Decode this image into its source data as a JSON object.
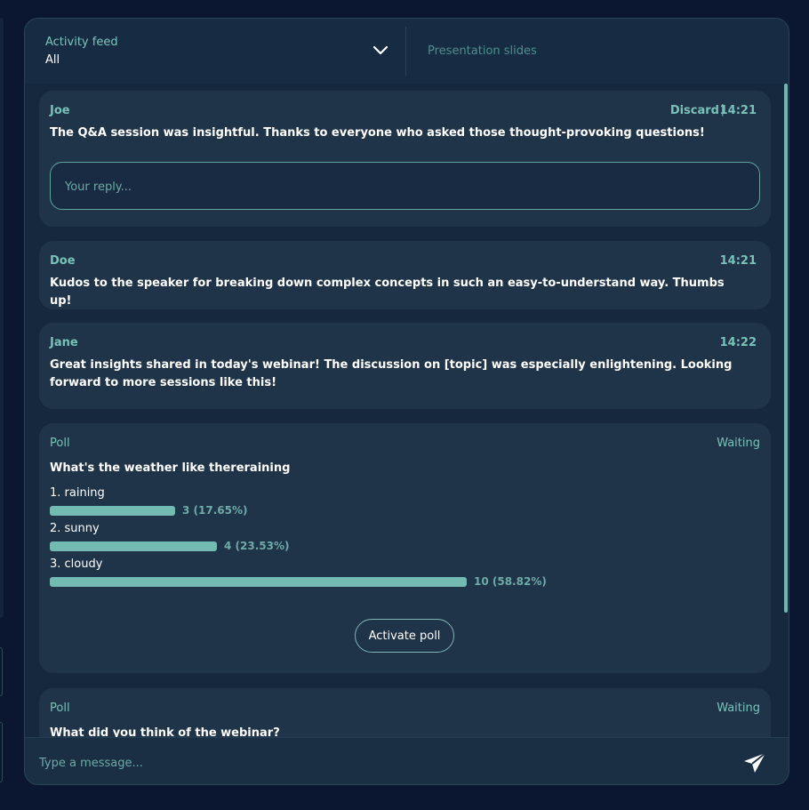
{
  "header": {
    "feed_label": "Activity feed",
    "feed_value": "All",
    "slides_tab": "Presentation slides"
  },
  "messages": [
    {
      "name": "Joe",
      "discard": "Discard",
      "separator": "|",
      "time": "14:21",
      "text": "The Q&A session was insightful. Thanks to everyone who asked those thought-provoking questions!",
      "reply_placeholder": "Your reply..."
    },
    {
      "name": "Doe",
      "time": "14:21",
      "text": "Kudos to the speaker for breaking down complex concepts in such an easy-to-understand way. Thumbs up!"
    },
    {
      "name": "Jane",
      "time": "14:22",
      "text": "Great insights shared in today's webinar! The discussion on [topic] was especially enlightening. Looking forward to more sessions like this!"
    }
  ],
  "polls": [
    {
      "tag": "Poll",
      "status": "Waiting",
      "question": "What's the weather like thereraining",
      "options": [
        {
          "label": "1. raining",
          "value": "3 (17.65%)",
          "fraction": 0.1765
        },
        {
          "label": "2. sunny",
          "value": "4 (23.53%)",
          "fraction": 0.2353
        },
        {
          "label": "3. cloudy",
          "value": "10 (58.82%)",
          "fraction": 0.5882
        }
      ],
      "action": "Activate poll"
    },
    {
      "tag": "Poll",
      "status": "Waiting",
      "question": "What did you think of the webinar?"
    }
  ],
  "composer": {
    "placeholder": "Type a message..."
  },
  "icons": {
    "dropdown": "chevron-down-icon",
    "send": "send-icon"
  },
  "colors": {
    "accent": "#78c3b9",
    "background": "#0b1730",
    "card": "#203449"
  }
}
